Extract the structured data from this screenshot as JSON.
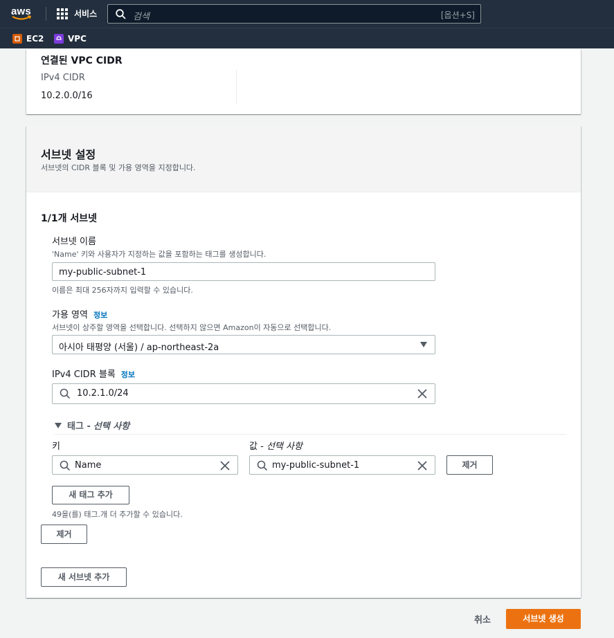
{
  "nav": {
    "logo_text": "aws",
    "services_label": "서비스",
    "search_placeholder": "검색",
    "search_shortcut": "[옵션+S]",
    "favorites": [
      {
        "label": "EC2",
        "color": "#d45b07"
      },
      {
        "label": "VPC",
        "color": "#7d3cdc"
      }
    ]
  },
  "vpc_cidr_panel": {
    "title": "연결된 VPC CIDR",
    "ipv4_label": "IPv4 CIDR",
    "ipv4_value": "10.2.0.0/16"
  },
  "subnet_settings": {
    "title": "서브넷 설정",
    "description": "서브넷의 CIDR 블록 및 가용 영역을 지정합니다.",
    "count_label": "1/1개 서브넷",
    "name_field": {
      "label": "서브넷 이름",
      "description": "'Name' 키와 사용자가 지정하는 값을 포함하는 태그를 생성합니다.",
      "value": "my-public-subnet-1",
      "hint": "이름은 최대 256자까지 입력할 수 있습니다."
    },
    "az_field": {
      "label": "가용 영역",
      "info_link": "정보",
      "description": "서브넷이 상주할 영역을 선택합니다. 선택하지 않으면 Amazon이 자동으로 선택합니다.",
      "value": "아시아 태평양 (서울) / ap-northeast-2a"
    },
    "cidr_field": {
      "label": "IPv4 CIDR 블록",
      "info_link": "정보",
      "value": "10.2.1.0/24"
    },
    "tags": {
      "toggle_label": "태그 -",
      "toggle_optional": "선택 사항",
      "key_label": "키",
      "value_label": "값 -",
      "value_optional": "선택 사항",
      "key_value": "Name",
      "value_value": "my-public-subnet-1",
      "remove_tag_button": "제거",
      "add_tag_button": "새 태그 추가",
      "remaining_hint": "49을(를) 태그.개 더 추가할 수 있습니다."
    },
    "remove_subnet_button": "제거",
    "add_subnet_button": "새 서브넷 추가"
  },
  "footer": {
    "cancel_label": "취소",
    "create_label": "서브넷 생성"
  }
}
